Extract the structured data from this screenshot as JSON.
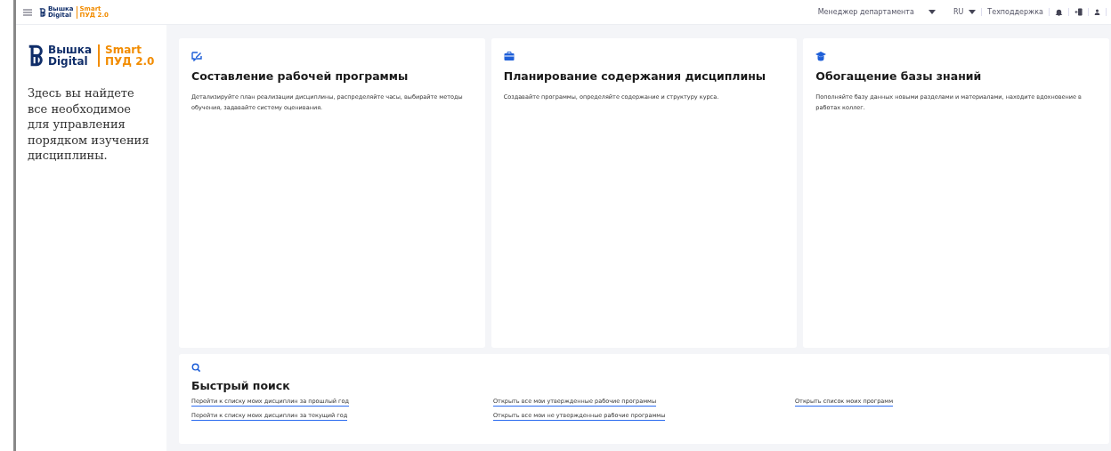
{
  "header": {
    "logo": {
      "line1": "Вышка",
      "line2": "Digital",
      "product1": "Smart",
      "product2": "ПУД 2.0"
    },
    "role": "Менеджер департамента",
    "language": "RU",
    "support": "Техподдержка"
  },
  "sidebar": {
    "logo": {
      "line1": "Вышка",
      "line2": "Digital",
      "product1": "Smart",
      "product2": "ПУД 2.0"
    },
    "text": "Здесь вы найдете все необходимое для управления порядком изучения дисциплины."
  },
  "cards": [
    {
      "kind": "edit",
      "title": "Составление рабочей программы",
      "description": "Детализируйте план реализации дисциплины, распределяйте часы, выбирайте методы обучения, задавайте систему оценивания."
    },
    {
      "kind": "briefcase",
      "title": "Планирование содержания дисциплины",
      "description": "Создавайте программы, определяйте содержание и структуру курса."
    },
    {
      "kind": "graduation",
      "title": "Обогащение базы знаний",
      "description": "Пополняйте базу данных новыми разделами и материалами, находите вдохновение в работах коллег."
    }
  ],
  "quick_search": {
    "title": "Быстрый поиск",
    "columns": [
      [
        "Перейти к списку моих дисциплин за прошлый год",
        "Перейти к списку моих дисциплин за текущий год"
      ],
      [
        "Открыть все мои утвержденные рабочие программы",
        "Открыть все мои не утвержденные рабочие программы"
      ],
      [
        "Открыть список моих программ"
      ]
    ]
  }
}
